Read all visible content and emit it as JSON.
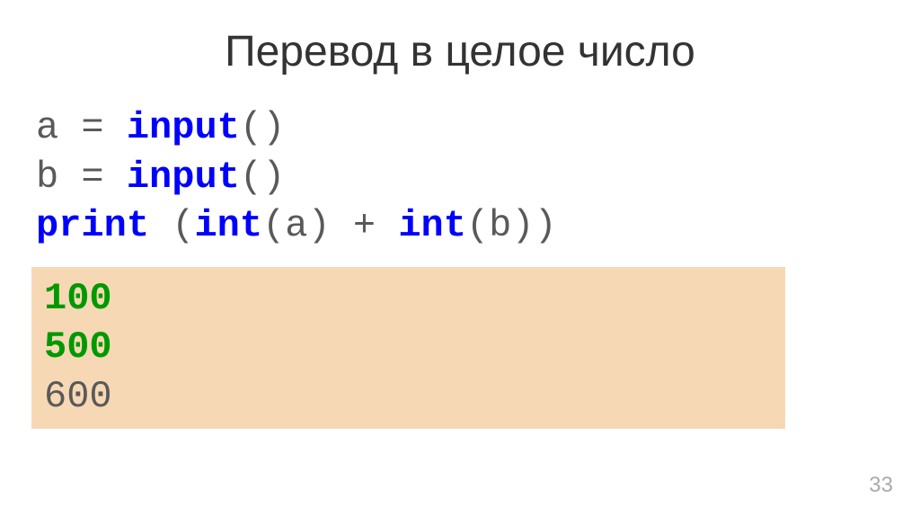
{
  "title": "Перевод в целое число",
  "code": {
    "line1": {
      "var": "a = ",
      "func": "input",
      "parens": "()"
    },
    "line2": {
      "var": "b = ",
      "func": "input",
      "parens": "()"
    },
    "line3": {
      "print": "print",
      "space_paren": " (",
      "int1": "int",
      "arg1": "(a) + ",
      "int2": "int",
      "arg2": "(b))"
    }
  },
  "output": {
    "line1": "100",
    "line2": "500",
    "line3": "600"
  },
  "pageNumber": "33"
}
